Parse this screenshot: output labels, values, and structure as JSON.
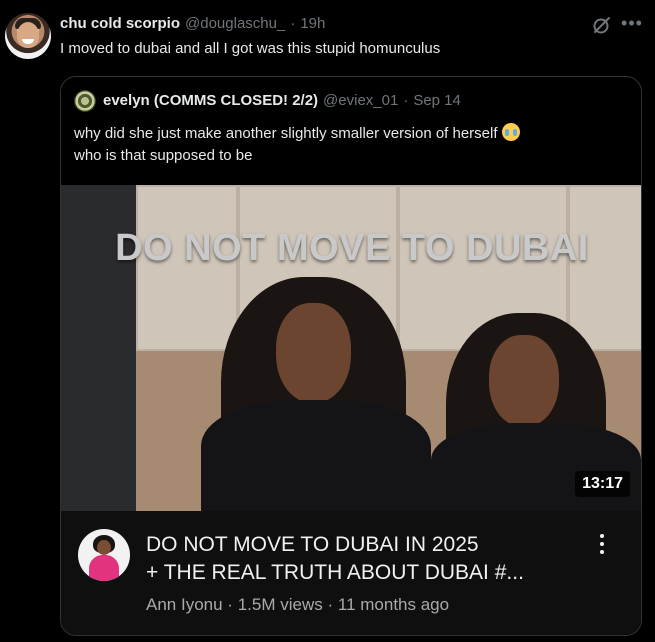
{
  "tweet": {
    "display_name": "chu cold scorpio",
    "handle": "@douglaschu_",
    "separator": "·",
    "time": "19h",
    "text": "I moved to dubai and all I got was this stupid homunculus",
    "avatar_icon": "user-avatar-icon",
    "grok_icon": "grok-icon",
    "more_icon": "more-horizontal-icon"
  },
  "quote": {
    "display_name": "evelyn (COMMS CLOSED! 2/2)",
    "handle": "@eviex_01",
    "separator": "·",
    "date": "Sep 14",
    "text_line1": "why did she just make another slightly smaller version of herself",
    "emoji_icon": "loudly-crying-face-icon",
    "text_line2": "who is that supposed to be"
  },
  "video": {
    "overlay_text": "DO NOT MOVE TO DUBAI",
    "duration": "13:17",
    "title_line1": "DO NOT MOVE TO DUBAI IN 2025",
    "title_line2": "+ THE REAL TRUTH ABOUT DUBAI #...",
    "channel": "Ann Iyonu",
    "views": "1.5M views",
    "age": "11 months ago",
    "meta_separator": "·",
    "more_icon": "more-vertical-icon"
  },
  "colors": {
    "background": "#000000",
    "text_primary": "#e7e9ea",
    "text_secondary": "#71767b",
    "border": "#2f3336",
    "yt_background": "#0f0f0f"
  }
}
